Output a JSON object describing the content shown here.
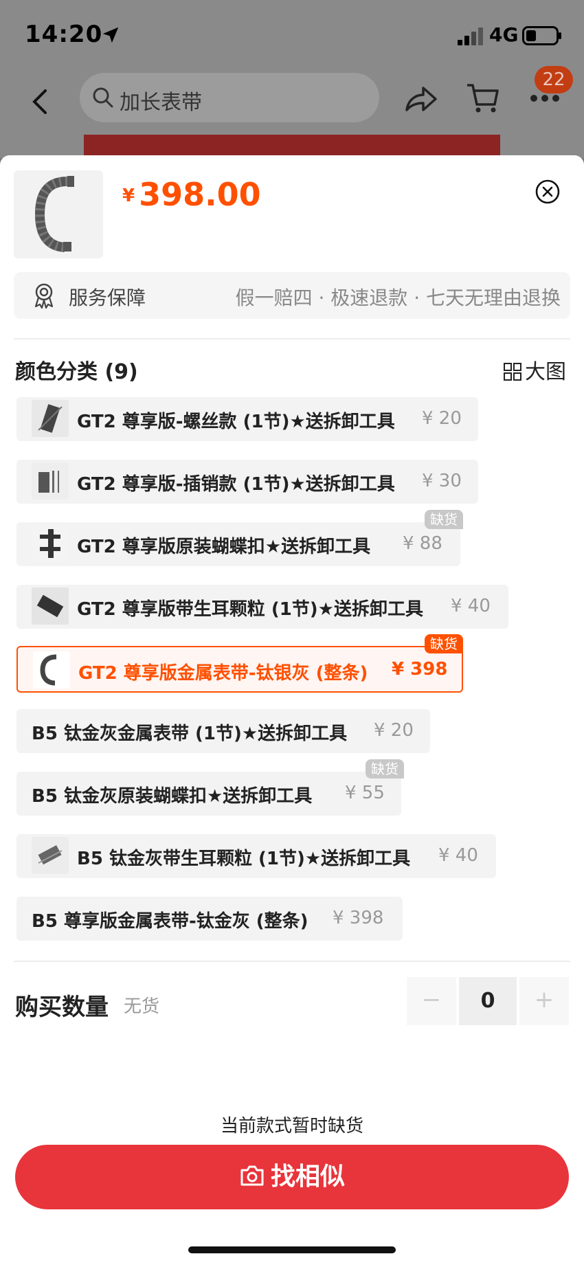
{
  "status_bar": {
    "time": "14:20",
    "network": "4G"
  },
  "nav": {
    "search_text": "加长表带",
    "cart_badge": "22"
  },
  "product": {
    "currency": "¥",
    "price": "398.00"
  },
  "service": {
    "title": "服务保障",
    "detail": "假一赔四 · 极速退款 · 七天无理由退换"
  },
  "color_section": {
    "title": "颜色分类 (9)",
    "big_image_label": "大图"
  },
  "options": [
    {
      "label": "GT2 尊享版-螺丝款 (1节)★送拆卸工具",
      "price": "¥ 20",
      "out_of_stock": "",
      "selected": false
    },
    {
      "label": "GT2 尊享版-插销款 (1节)★送拆卸工具",
      "price": "¥ 30",
      "out_of_stock": "",
      "selected": false
    },
    {
      "label": "GT2 尊享版原装蝴蝶扣★送拆卸工具",
      "price": "¥ 88",
      "out_of_stock": "缺货",
      "selected": false
    },
    {
      "label": "GT2 尊享版带生耳颗粒 (1节)★送拆卸工具",
      "price": "¥ 40",
      "out_of_stock": "",
      "selected": false
    },
    {
      "label": "GT2 尊享版金属表带-钛银灰 (整条)",
      "price": "¥ 398",
      "out_of_stock": "缺货",
      "selected": true
    },
    {
      "label": "B5 钛金灰金属表带 (1节)★送拆卸工具",
      "price": "¥ 20",
      "out_of_stock": "",
      "selected": false
    },
    {
      "label": "B5 钛金灰原装蝴蝶扣★送拆卸工具",
      "price": "¥ 55",
      "out_of_stock": "缺货",
      "selected": false
    },
    {
      "label": "B5 钛金灰带生耳颗粒 (1节)★送拆卸工具",
      "price": "¥ 40",
      "out_of_stock": "",
      "selected": false
    },
    {
      "label": "B5 尊享版金属表带-钛金灰 (整条)",
      "price": "¥ 398",
      "out_of_stock": "",
      "selected": false
    }
  ],
  "quantity": {
    "title": "购买数量",
    "status": "无货",
    "minus": "−",
    "value": "0",
    "plus": "+"
  },
  "footer": {
    "note": "当前款式暂时缺货",
    "button_label": "找相似"
  },
  "colors": {
    "accent": "#ff5000",
    "button": "#e8343b"
  }
}
